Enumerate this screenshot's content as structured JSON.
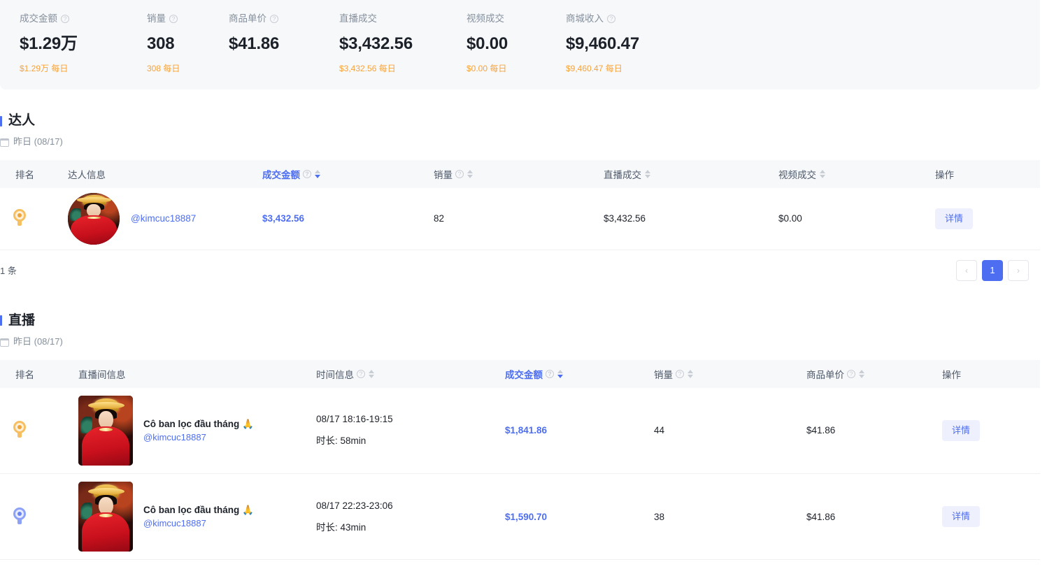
{
  "stats": [
    {
      "label": "成交金额",
      "has_info": true,
      "value": "$1.29万",
      "sub": "$1.29万 每日"
    },
    {
      "label": "销量",
      "has_info": true,
      "value": "308",
      "sub": "308 每日"
    },
    {
      "label": "商品单价",
      "has_info": true,
      "value": "$41.86",
      "sub": ""
    },
    {
      "label": "直播成交",
      "has_info": false,
      "value": "$3,432.56",
      "sub": "$3,432.56 每日"
    },
    {
      "label": "视频成交",
      "has_info": false,
      "value": "$0.00",
      "sub": "$0.00 每日"
    },
    {
      "label": "商城收入",
      "has_info": true,
      "value": "$9,460.47",
      "sub": "$9,460.47 每日"
    }
  ],
  "talent_section": {
    "title": "达人",
    "date": "昨日 (08/17)",
    "columns": [
      {
        "label": "排名",
        "info": false,
        "sort": false,
        "sorted": false
      },
      {
        "label": "达人信息",
        "info": false,
        "sort": false,
        "sorted": false
      },
      {
        "label": "成交金额",
        "info": true,
        "sort": true,
        "sorted": true
      },
      {
        "label": "销量",
        "info": true,
        "sort": true,
        "sorted": false
      },
      {
        "label": "直播成交",
        "info": false,
        "sort": true,
        "sorted": false
      },
      {
        "label": "视频成交",
        "info": false,
        "sort": true,
        "sorted": false
      },
      {
        "label": "操作",
        "info": false,
        "sort": false,
        "sorted": false
      }
    ],
    "rows": [
      {
        "rank": 1,
        "handle": "@kimcuc18887",
        "gmv": "$3,432.56",
        "sales": "82",
        "live_gmv": "$3,432.56",
        "video_gmv": "$0.00",
        "action": "详情"
      }
    ],
    "total_text": "1 条",
    "pagination": {
      "prev": "‹",
      "pages": [
        "1"
      ],
      "current": "1",
      "next": "›"
    }
  },
  "live_section": {
    "title": "直播",
    "date": "昨日 (08/17)",
    "columns": [
      {
        "label": "排名",
        "info": false,
        "sort": false,
        "sorted": false
      },
      {
        "label": "直播间信息",
        "info": false,
        "sort": false,
        "sorted": false
      },
      {
        "label": "时间信息",
        "info": true,
        "sort": true,
        "sorted": false
      },
      {
        "label": "成交金额",
        "info": true,
        "sort": true,
        "sorted": true
      },
      {
        "label": "销量",
        "info": true,
        "sort": true,
        "sorted": false
      },
      {
        "label": "商品单价",
        "info": true,
        "sort": true,
        "sorted": false
      },
      {
        "label": "操作",
        "info": false,
        "sort": false,
        "sorted": false
      }
    ],
    "rows": [
      {
        "rank": 1,
        "room_title": "Cô ban lọc đầu tháng 🙏",
        "handle": "@kimcuc18887",
        "time_range": "08/17 18:16-19:15",
        "duration": "时长: 58min",
        "gmv": "$1,841.86",
        "sales": "44",
        "unit_price": "$41.86",
        "action": "详情"
      },
      {
        "rank": 2,
        "room_title": "Cô ban lọc đầu tháng 🙏",
        "handle": "@kimcuc18887",
        "time_range": "08/17 22:23-23:06",
        "duration": "时长: 43min",
        "gmv": "$1,590.70",
        "sales": "38",
        "unit_price": "$41.86",
        "action": "详情"
      }
    ]
  },
  "colors": {
    "accent": "#4e6ef2",
    "sub_orange": "#f7a33a",
    "header_bg": "#f7f8fa",
    "text": "#1d2129",
    "muted": "#86909c"
  }
}
